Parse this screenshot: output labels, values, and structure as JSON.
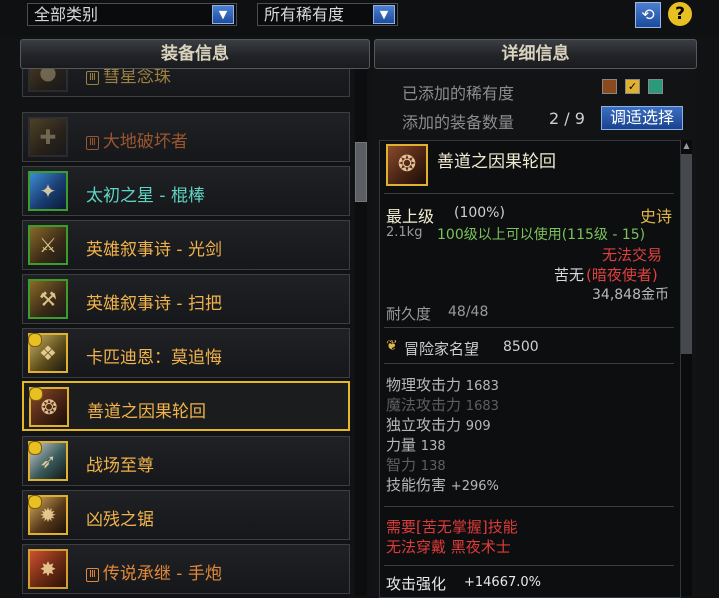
{
  "filters": {
    "category": "全部类别",
    "rarity": "所有稀有度"
  },
  "panels": {
    "left_header": "装备信息",
    "right_header": "详细信息"
  },
  "list": [
    {
      "name": "彗星念珠",
      "tag": "Ⅲ",
      "color": "#c9a24a",
      "dim": true
    },
    {
      "name": "大地破坏者",
      "tag": "Ⅲ",
      "color": "#c56a34",
      "dim": true
    },
    {
      "name": "太初之星 - 棍棒",
      "tag": "",
      "color": "#5fd6c4",
      "dim": false
    },
    {
      "name": "英雄叙事诗 - 光剑",
      "tag": "",
      "color": "#f0b24a",
      "dim": false
    },
    {
      "name": "英雄叙事诗 - 扫把",
      "tag": "",
      "color": "#f0b24a",
      "dim": false
    },
    {
      "name": "卡匹迪恩：莫追悔",
      "tag": "",
      "color": "#f0b24a",
      "dim": false
    },
    {
      "name": "善道之因果轮回",
      "tag": "",
      "color": "#f0b24a",
      "dim": false,
      "selected": true
    },
    {
      "name": "战场至尊",
      "tag": "",
      "color": "#f0b24a",
      "dim": false
    },
    {
      "name": "凶残之锯",
      "tag": "",
      "color": "#f0b24a",
      "dim": false
    },
    {
      "name": "传说承继 - 手炮",
      "tag": "Ⅲ",
      "color": "#e0883a",
      "dim": false
    }
  ],
  "detail": {
    "added_rarity_label": "已添加的稀有度",
    "added_count_label": "添加的装备数量",
    "added_count": "2 / 9",
    "choose_button": "调适选择",
    "rarity_colors": [
      "#8a4a1e",
      "#e0b030",
      "#2a9a7a"
    ],
    "item": {
      "name": "善道之因果轮回",
      "grade": "最上级",
      "grade_pct": "(100%)",
      "rarity": "史诗",
      "weight": "2.1kg",
      "level_req": "100级以上可以使用(115级 - 15)",
      "trade": "无法交易",
      "owner": "苦无",
      "owner_class": "(暗夜使者)",
      "price": "34,848金币",
      "durability_label": "耐久度",
      "durability": "48/48",
      "fame_label": "冒险家名望",
      "fame": "8500",
      "stats": [
        {
          "label": "物理攻击力",
          "value": "1683",
          "active": true
        },
        {
          "label": "魔法攻击力",
          "value": "1683",
          "active": false
        },
        {
          "label": "独立攻击力",
          "value": "909",
          "active": true
        },
        {
          "label": "力量",
          "value": "138",
          "active": true
        },
        {
          "label": "智力",
          "value": "138",
          "active": false
        },
        {
          "label": "技能伤害",
          "value": "+296%",
          "active": true
        }
      ],
      "req1": "需要[苦无掌握]技能",
      "req2": "无法穿戴 黑夜术士",
      "enhance_label": "攻击强化",
      "enhance_value": "+14667.0%"
    }
  }
}
